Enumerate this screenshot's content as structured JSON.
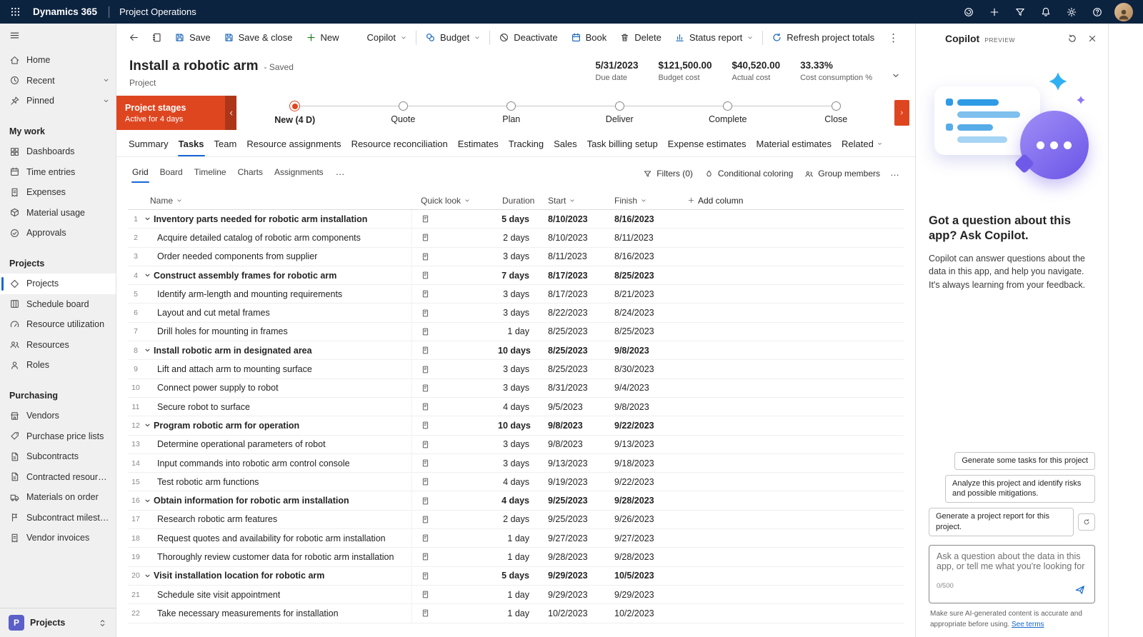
{
  "topbar": {
    "brand": "Dynamics 365",
    "app": "Project Operations",
    "icons": [
      {
        "icon": "pulse",
        "label": "insights"
      },
      {
        "icon": "plus",
        "label": "add"
      },
      {
        "icon": "funnel",
        "label": "filter"
      },
      {
        "icon": "bell",
        "label": "notifications"
      },
      {
        "icon": "gear",
        "label": "settings"
      },
      {
        "icon": "help",
        "label": "help"
      }
    ]
  },
  "sidebar": {
    "items": [
      {
        "icon": "home",
        "label": "Home"
      },
      {
        "icon": "clock",
        "label": "Recent",
        "chevron": true
      },
      {
        "icon": "pin",
        "label": "Pinned",
        "chevron": true
      },
      {
        "header": true,
        "label": "My work",
        "name": "sidebar-section-my-work"
      },
      {
        "icon": "grid4",
        "label": "Dashboards"
      },
      {
        "icon": "cal",
        "label": "Time entries"
      },
      {
        "icon": "receipt",
        "label": "Expenses"
      },
      {
        "icon": "box",
        "label": "Material usage"
      },
      {
        "icon": "checkc",
        "label": "Approvals"
      },
      {
        "header": true,
        "label": "Projects",
        "name": "sidebar-section-projects"
      },
      {
        "icon": "diamond",
        "label": "Projects",
        "selected": true
      },
      {
        "icon": "board",
        "label": "Schedule board"
      },
      {
        "icon": "gauge",
        "label": "Resource utilization"
      },
      {
        "icon": "people",
        "label": "Resources"
      },
      {
        "icon": "person",
        "label": "Roles"
      },
      {
        "header": true,
        "label": "Purchasing",
        "name": "sidebar-section-purchasing"
      },
      {
        "icon": "store",
        "label": "Vendors"
      },
      {
        "icon": "tag",
        "label": "Purchase price lists"
      },
      {
        "icon": "doc",
        "label": "Subcontracts"
      },
      {
        "icon": "doc",
        "label": "Contracted resource..."
      },
      {
        "icon": "truck",
        "label": "Materials on order"
      },
      {
        "icon": "flag",
        "label": "Subcontract milestones"
      },
      {
        "icon": "receipt",
        "label": "Vendor invoices"
      }
    ],
    "footer": {
      "badge": "P",
      "label": "Projects"
    }
  },
  "commandbar": {
    "items": [
      {
        "icon": "floppy",
        "label": "Save"
      },
      {
        "icon": "floppy",
        "label": "Save & close"
      },
      {
        "icon": "plus",
        "label": "New",
        "green": true
      },
      {
        "icon": "copilot",
        "label": "Copilot",
        "dropdown": true
      },
      {
        "divider": true,
        "name": "command-divider"
      },
      {
        "icon": "coins",
        "label": "Budget",
        "dropdown": true
      },
      {
        "divider": true,
        "name": "command-divider"
      },
      {
        "icon": "ban",
        "label": "Deactivate",
        "dark": true
      },
      {
        "icon": "cal",
        "label": "Book"
      },
      {
        "icon": "trash",
        "label": "Delete",
        "dark": true
      },
      {
        "icon": "chart",
        "label": "Status report",
        "dropdown": true
      },
      {
        "divider": true,
        "name": "command-divider"
      },
      {
        "icon": "refresh",
        "label": "Refresh project totals"
      }
    ],
    "more": "⋮"
  },
  "header": {
    "title": "Install a robotic arm",
    "status": "- Saved",
    "subtitle": "Project",
    "stats": [
      {
        "value": "5/31/2023",
        "label": "Due date"
      },
      {
        "value": "$121,500.00",
        "label": "Budget cost"
      },
      {
        "value": "$40,520.00",
        "label": "Actual cost"
      },
      {
        "value": "33.33%",
        "label": "Cost consumption %"
      }
    ]
  },
  "stages": {
    "banner_title": "Project stages",
    "banner_subtitle": "Active for 4 days",
    "items": [
      {
        "label": "New (4 D)",
        "active": true
      },
      {
        "label": "Quote"
      },
      {
        "label": "Plan"
      },
      {
        "label": "Deliver"
      },
      {
        "label": "Complete"
      },
      {
        "label": "Close"
      }
    ]
  },
  "tabs": {
    "items": [
      {
        "label": "Summary"
      },
      {
        "label": "Tasks",
        "selected": true
      },
      {
        "label": "Team"
      },
      {
        "label": "Resource assignments"
      },
      {
        "label": "Resource reconciliation"
      },
      {
        "label": "Estimates"
      },
      {
        "label": "Tracking"
      },
      {
        "label": "Sales"
      },
      {
        "label": "Task billing setup"
      },
      {
        "label": "Expense estimates"
      },
      {
        "label": "Material estimates"
      },
      {
        "label": "Related",
        "dropdown": true
      }
    ]
  },
  "view": {
    "tabs": [
      {
        "label": "Grid",
        "selected": true
      },
      {
        "label": "Board"
      },
      {
        "label": "Timeline"
      },
      {
        "label": "Charts"
      },
      {
        "label": "Assignments"
      }
    ],
    "more": "…",
    "actions": [
      {
        "icon": "funnel",
        "label": "Filters (0)"
      },
      {
        "icon": "droplet",
        "label": "Conditional coloring"
      },
      {
        "icon": "people",
        "label": "Group members"
      }
    ]
  },
  "table": {
    "columns": [
      "Name",
      "Quick look",
      "Duration",
      "Start",
      "Finish"
    ],
    "add_column": "Add column",
    "rows": [
      {
        "n": 1,
        "name": "Inventory parts needed for robotic arm installation",
        "dur": "5 days",
        "start": "8/10/2023",
        "finish": "8/16/2023",
        "parent": true
      },
      {
        "n": 2,
        "name": "Acquire detailed catalog of robotic arm components",
        "dur": "2 days",
        "start": "8/10/2023",
        "finish": "8/11/2023"
      },
      {
        "n": 3,
        "name": "Order needed components from supplier",
        "dur": "3 days",
        "start": "8/11/2023",
        "finish": "8/16/2023"
      },
      {
        "n": 4,
        "name": "Construct assembly frames for robotic arm",
        "dur": "7 days",
        "start": "8/17/2023",
        "finish": "8/25/2023",
        "parent": true
      },
      {
        "n": 5,
        "name": "Identify arm-length and mounting requirements",
        "dur": "3 days",
        "start": "8/17/2023",
        "finish": "8/21/2023"
      },
      {
        "n": 6,
        "name": "Layout and cut metal frames",
        "dur": "3 days",
        "start": "8/22/2023",
        "finish": "8/24/2023"
      },
      {
        "n": 7,
        "name": "Drill holes for mounting in frames",
        "dur": "1 day",
        "start": "8/25/2023",
        "finish": "8/25/2023"
      },
      {
        "n": 8,
        "name": "Install robotic arm in designated area",
        "dur": "10 days",
        "start": "8/25/2023",
        "finish": "9/8/2023",
        "parent": true
      },
      {
        "n": 9,
        "name": "Lift and attach arm to mounting surface",
        "dur": "3 days",
        "start": "8/25/2023",
        "finish": "8/30/2023"
      },
      {
        "n": 10,
        "name": "Connect power supply to robot",
        "dur": "3 days",
        "start": "8/31/2023",
        "finish": "9/4/2023"
      },
      {
        "n": 11,
        "name": "Secure robot to surface",
        "dur": "4 days",
        "start": "9/5/2023",
        "finish": "9/8/2023"
      },
      {
        "n": 12,
        "name": "Program robotic arm for operation",
        "dur": "10 days",
        "start": "9/8/2023",
        "finish": "9/22/2023",
        "parent": true
      },
      {
        "n": 13,
        "name": "Determine operational parameters of robot",
        "dur": "3 days",
        "start": "9/8/2023",
        "finish": "9/13/2023"
      },
      {
        "n": 14,
        "name": "Input commands into robotic arm control console",
        "dur": "3 days",
        "start": "9/13/2023",
        "finish": "9/18/2023"
      },
      {
        "n": 15,
        "name": "Test robotic arm functions",
        "dur": "4 days",
        "start": "9/19/2023",
        "finish": "9/22/2023"
      },
      {
        "n": 16,
        "name": "Obtain information for robotic arm installation",
        "dur": "4 days",
        "start": "9/25/2023",
        "finish": "9/28/2023",
        "parent": true
      },
      {
        "n": 17,
        "name": "Research robotic arm features",
        "dur": "2 days",
        "start": "9/25/2023",
        "finish": "9/26/2023"
      },
      {
        "n": 18,
        "name": "Request quotes and availability for robotic arm installation",
        "dur": "1 day",
        "start": "9/27/2023",
        "finish": "9/27/2023"
      },
      {
        "n": 19,
        "name": "Thoroughly review customer data for robotic arm installation",
        "dur": "1 day",
        "start": "9/28/2023",
        "finish": "9/28/2023"
      },
      {
        "n": 20,
        "name": "Visit installation location for robotic arm",
        "dur": "5 days",
        "start": "9/29/2023",
        "finish": "10/5/2023",
        "parent": true
      },
      {
        "n": 21,
        "name": "Schedule site visit appointment",
        "dur": "1 day",
        "start": "9/29/2023",
        "finish": "9/29/2023"
      },
      {
        "n": 22,
        "name": "Take necessary measurements for installation",
        "dur": "1 day",
        "start": "10/2/2023",
        "finish": "10/2/2023"
      }
    ]
  },
  "copilot": {
    "title": "Copilot",
    "preview": "PREVIEW",
    "heading": "Got a question about this app? Ask Copilot.",
    "body": "Copilot can answer questions about the data in this app, and help you navigate. It's always learning from your feedback.",
    "chips": [
      {
        "label": "Generate some tasks for this project"
      },
      {
        "label": "Analyze this project and identify risks and possible mitigations."
      },
      {
        "label": "Generate a project report for this project.",
        "regen": true
      }
    ],
    "input_placeholder": "Ask a question about the data in this app, or tell me what you're looking for",
    "char_count": "0/500",
    "footer": "Make sure AI-generated content is accurate and appropriate before using.",
    "footer_link": "See terms"
  },
  "colors": {
    "accent": "#1a66d6",
    "stage_red": "#de4620",
    "topbar_bg": "#0c2340",
    "copilot_purple": "#6f59e8",
    "area_tile": "#5b5fc7",
    "new_green": "#107c10"
  }
}
